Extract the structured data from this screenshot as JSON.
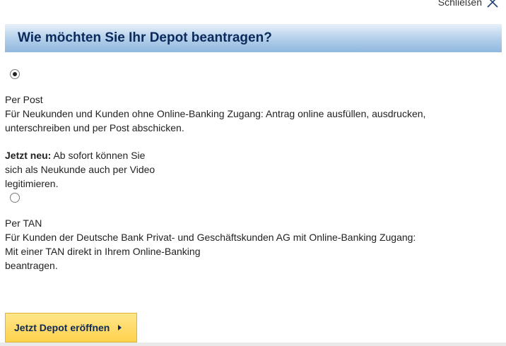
{
  "close": {
    "label": "Schließen",
    "icon": "close-icon"
  },
  "title": "Wie möchten Sie Ihr Depot beantragen?",
  "options": [
    {
      "selected": true,
      "heading": "Per Post",
      "line1": "Für Neukunden und Kunden ohne Online-Banking Zugang: Antrag online ausfüllen, ausdrucken,",
      "line2": "unterschreiben und per Post abschicken.",
      "note_bold": "Jetzt neu:",
      "note_line1": " Ab sofort können Sie",
      "note_line2": "sich als Neukunde auch per Video",
      "note_line3": "legitimieren."
    },
    {
      "selected": false,
      "heading": "Per TAN",
      "line1": "Für Kunden der Deutsche Bank Privat- und Geschäftskunden AG mit Online-Banking Zugang:",
      "line2": "Mit einer TAN direkt in Ihrem Online-Banking",
      "line3": "beantragen."
    }
  ],
  "cta_label": "Jetzt Depot eröffnen",
  "colors": {
    "title_text": "#0b2a5b",
    "cta_background": "#ffd24d"
  }
}
